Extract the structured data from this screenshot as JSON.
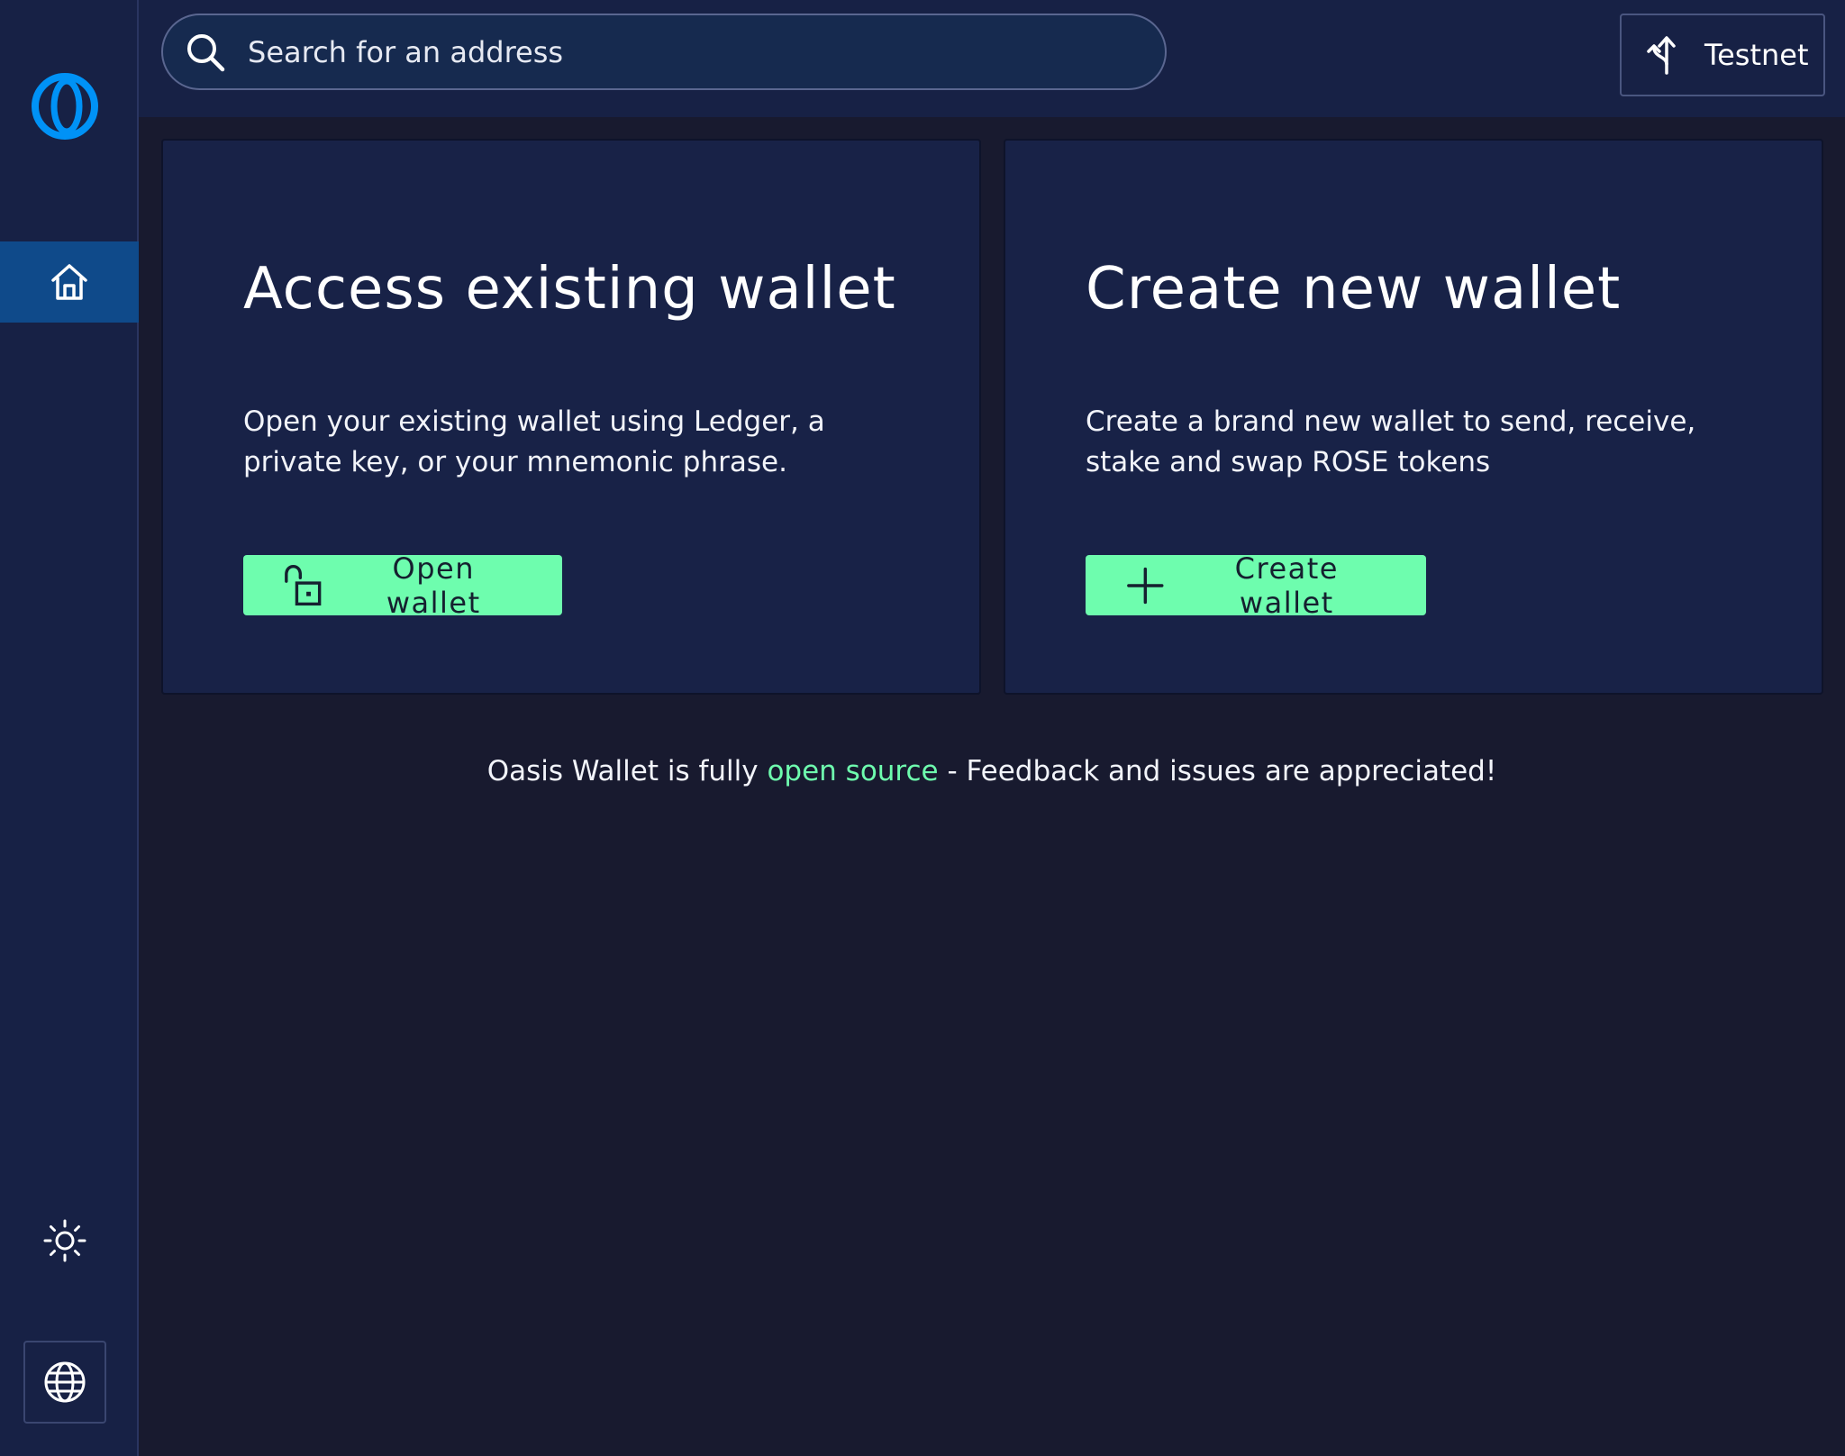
{
  "header": {
    "search_placeholder": "Search for an address",
    "network_label": "Testnet"
  },
  "cards": {
    "access": {
      "title": "Access existing wallet",
      "description": "Open your existing wallet using Ledger, a private key, or your mnemonic phrase.",
      "button_label": "Open wallet"
    },
    "create": {
      "title": "Create new wallet",
      "description": "Create a brand new wallet to send, receive, stake and swap ROSE tokens",
      "button_label": "Create wallet"
    }
  },
  "footer": {
    "prefix": "Oasis Wallet is fully ",
    "link_text": "open source",
    "suffix": " - Feedback and issues are appreciated!"
  },
  "colors": {
    "accent_green": "#6efdae",
    "brand_blue": "#0092f6",
    "nav_active": "#0f4a8a",
    "background": "#181a2f"
  },
  "icons": {
    "logo": "oasis-logo-icon",
    "home": "home-icon",
    "theme": "sun-icon",
    "language": "globe-icon",
    "search": "search-icon",
    "network": "network-switch-icon",
    "open": "unlock-icon",
    "create": "plus-icon"
  }
}
